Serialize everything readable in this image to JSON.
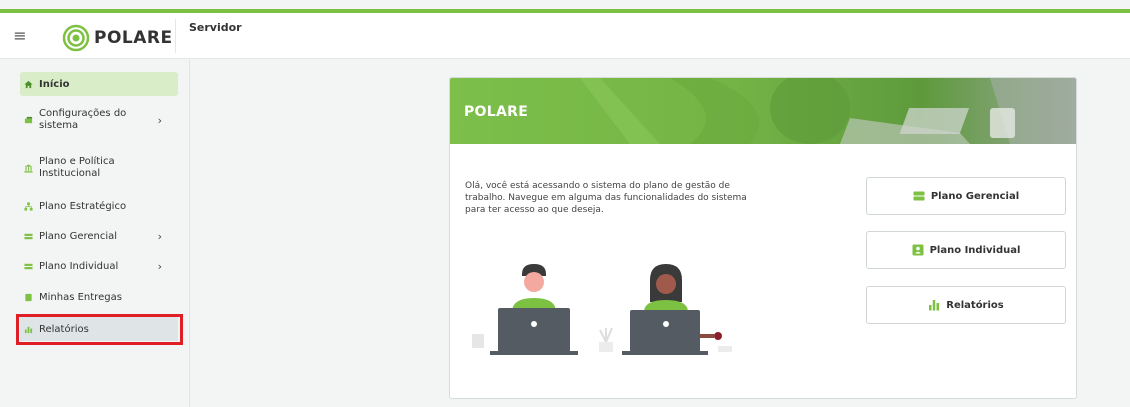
{
  "header": {
    "brand": "POLARE",
    "title": "Servidor",
    "menu_glyph": "≡"
  },
  "sidebar": {
    "items": [
      {
        "label": "Início",
        "icon": "home-icon"
      },
      {
        "label": "Configurações do sistema",
        "icon": "gear-icon",
        "has_children": true
      },
      {
        "label": "Plano e Política Institucional",
        "icon": "institution-icon"
      },
      {
        "label": "Plano Estratégico",
        "icon": "sitemap-icon"
      },
      {
        "label": "Plano Gerencial",
        "icon": "list-icon",
        "has_children": true
      },
      {
        "label": "Plano Individual",
        "icon": "list-icon",
        "has_children": true
      },
      {
        "label": "Minhas Entregas",
        "icon": "box-icon"
      },
      {
        "label": "Relatórios",
        "icon": "bar-chart-icon"
      }
    ],
    "chevron": "›"
  },
  "card": {
    "banner_title": "POLARE",
    "intro": "Olá, você está acessando o sistema do plano de gestão de trabalho. Navegue em alguma das funcionalidades do sistema para ter acesso ao que deseja.",
    "buttons": [
      {
        "label": "Plano Gerencial",
        "icon": "server-icon"
      },
      {
        "label": "Plano Individual",
        "icon": "id-card-icon"
      },
      {
        "label": "Relatórios",
        "icon": "bar-chart-icon"
      }
    ]
  },
  "colors": {
    "accent": "#7dc142",
    "active_bg": "#d9eec8",
    "highlight": "#e01e26"
  }
}
